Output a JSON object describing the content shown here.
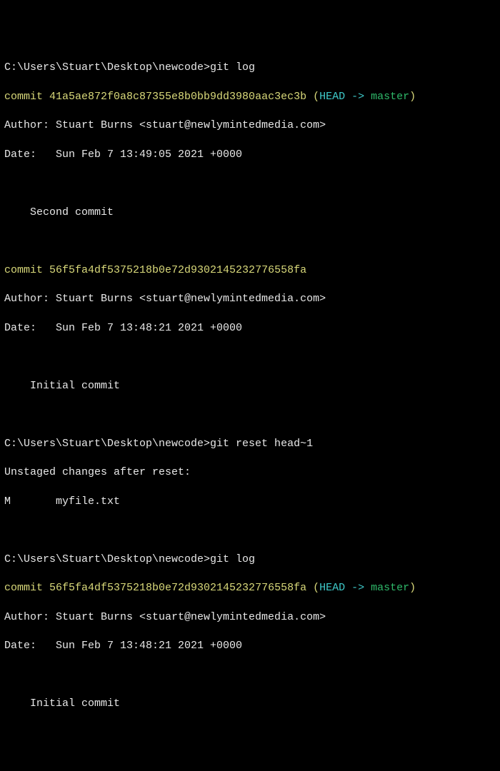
{
  "prompt1": {
    "path": "C:\\Users\\Stuart\\Desktop\\newcode>",
    "cmd": "git log"
  },
  "log1": {
    "commit_label": "commit ",
    "hash": "41a5ae872f0a8c87355e8b0bb9dd3980aac3ec3b",
    "ref_open": " (",
    "head": "HEAD -> ",
    "branch": "master",
    "ref_close": ")",
    "author": "Author: Stuart Burns <stuart@newlymintedmedia.com>",
    "date": "Date:   Sun Feb 7 13:49:05 2021 +0000",
    "msg": "    Second commit"
  },
  "log2": {
    "commit_label": "commit ",
    "hash": "56f5fa4df5375218b0e72d9302145232776558fa",
    "author": "Author: Stuart Burns <stuart@newlymintedmedia.com>",
    "date": "Date:   Sun Feb 7 13:48:21 2021 +0000",
    "msg": "    Initial commit"
  },
  "prompt2": {
    "path": "C:\\Users\\Stuart\\Desktop\\newcode>",
    "cmd": "git reset head~1"
  },
  "reset": {
    "header": "Unstaged changes after reset:",
    "line": "M       myfile.txt"
  },
  "prompt3": {
    "path": "C:\\Users\\Stuart\\Desktop\\newcode>",
    "cmd": "git log"
  },
  "log3": {
    "commit_label": "commit ",
    "hash": "56f5fa4df5375218b0e72d9302145232776558fa",
    "ref_open": " (",
    "head": "HEAD -> ",
    "branch": "master",
    "ref_close": ")",
    "author": "Author: Stuart Burns <stuart@newlymintedmedia.com>",
    "date": "Date:   Sun Feb 7 13:48:21 2021 +0000",
    "msg": "    Initial commit"
  }
}
